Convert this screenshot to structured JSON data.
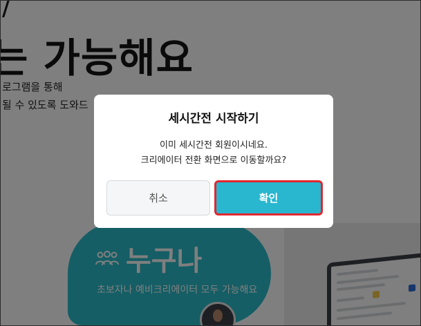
{
  "background": {
    "hero_mark": "/",
    "hero_heading": "는 가능해요",
    "hero_line_1": "로그램을 통해",
    "hero_line_2": "될 수 있도록 도와드",
    "card": {
      "icon": "people-icon",
      "title": "누구나",
      "subtitle": "초보자나 예비크리에이터 모두 가능해요",
      "color": "#2bbccb"
    }
  },
  "dialog": {
    "title": "세시간전 시작하기",
    "message_line_1": "이미 세시간전 회원이시네요.",
    "message_line_2": "크리에이터 전환 화면으로 이동할까요?",
    "cancel_label": "취소",
    "confirm_label": "확인",
    "confirm_color": "#29b6cf",
    "highlight_color": "#e3262f"
  }
}
